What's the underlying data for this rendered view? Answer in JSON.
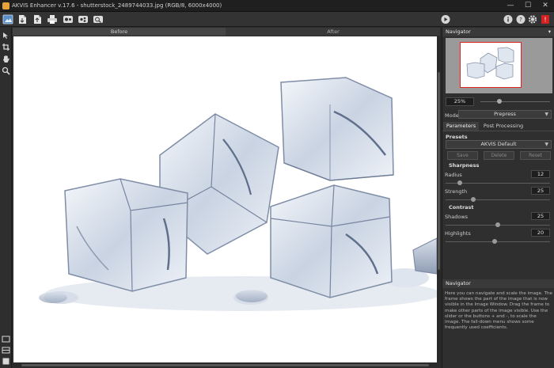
{
  "window": {
    "title": "AKVIS Enhancer v.17.6 - shutterstock_2489744033.jpg (RGB/8, 6000x4000)",
    "minimize": "—",
    "maximize": "☐",
    "close": "✕"
  },
  "toolbar": {
    "icons": [
      "open-image-icon",
      "save-icon",
      "save-as-icon",
      "print-icon",
      "batch-icon",
      "share-icon",
      "tools-icon"
    ]
  },
  "canvas_tabs": {
    "before": "Before",
    "after": "After"
  },
  "navigator": {
    "title": "Navigator",
    "collapse": "▾",
    "zoom": "25%",
    "zoom_slider_fraction": 0.25
  },
  "mode": {
    "label": "Mode:",
    "value": "Prepress"
  },
  "tabs": {
    "parameters": "Parameters",
    "post_processing": "Post Processing"
  },
  "presets": {
    "label": "Presets",
    "selected": "AKVIS Default",
    "save": "Save",
    "delete": "Delete",
    "reset": "Reset"
  },
  "sharpness": {
    "label": "Sharpness",
    "radius_label": "Radius",
    "radius": "12",
    "radius_fraction": 0.12,
    "strength_label": "Strength",
    "strength": "25",
    "strength_fraction": 0.25
  },
  "contrast": {
    "label": "Contrast",
    "shadows_label": "Shadows",
    "shadows": "25",
    "shadows_fraction": 0.5,
    "highlights_label": "Highlights",
    "highlights": "20",
    "highlights_fraction": 0.47
  },
  "help": {
    "title": "Navigator",
    "text": "Here you can navigate and scale the image. The frame shows the part of the image that is now visible in the Image Window. Drag the frame to make other parts of the image visible. Use the slider or the buttons + and -, to scale the image. The fall-down menu shows some frequently used coefficients."
  },
  "colors": {
    "accent": "#d22222",
    "background": "#2f2f2f"
  }
}
